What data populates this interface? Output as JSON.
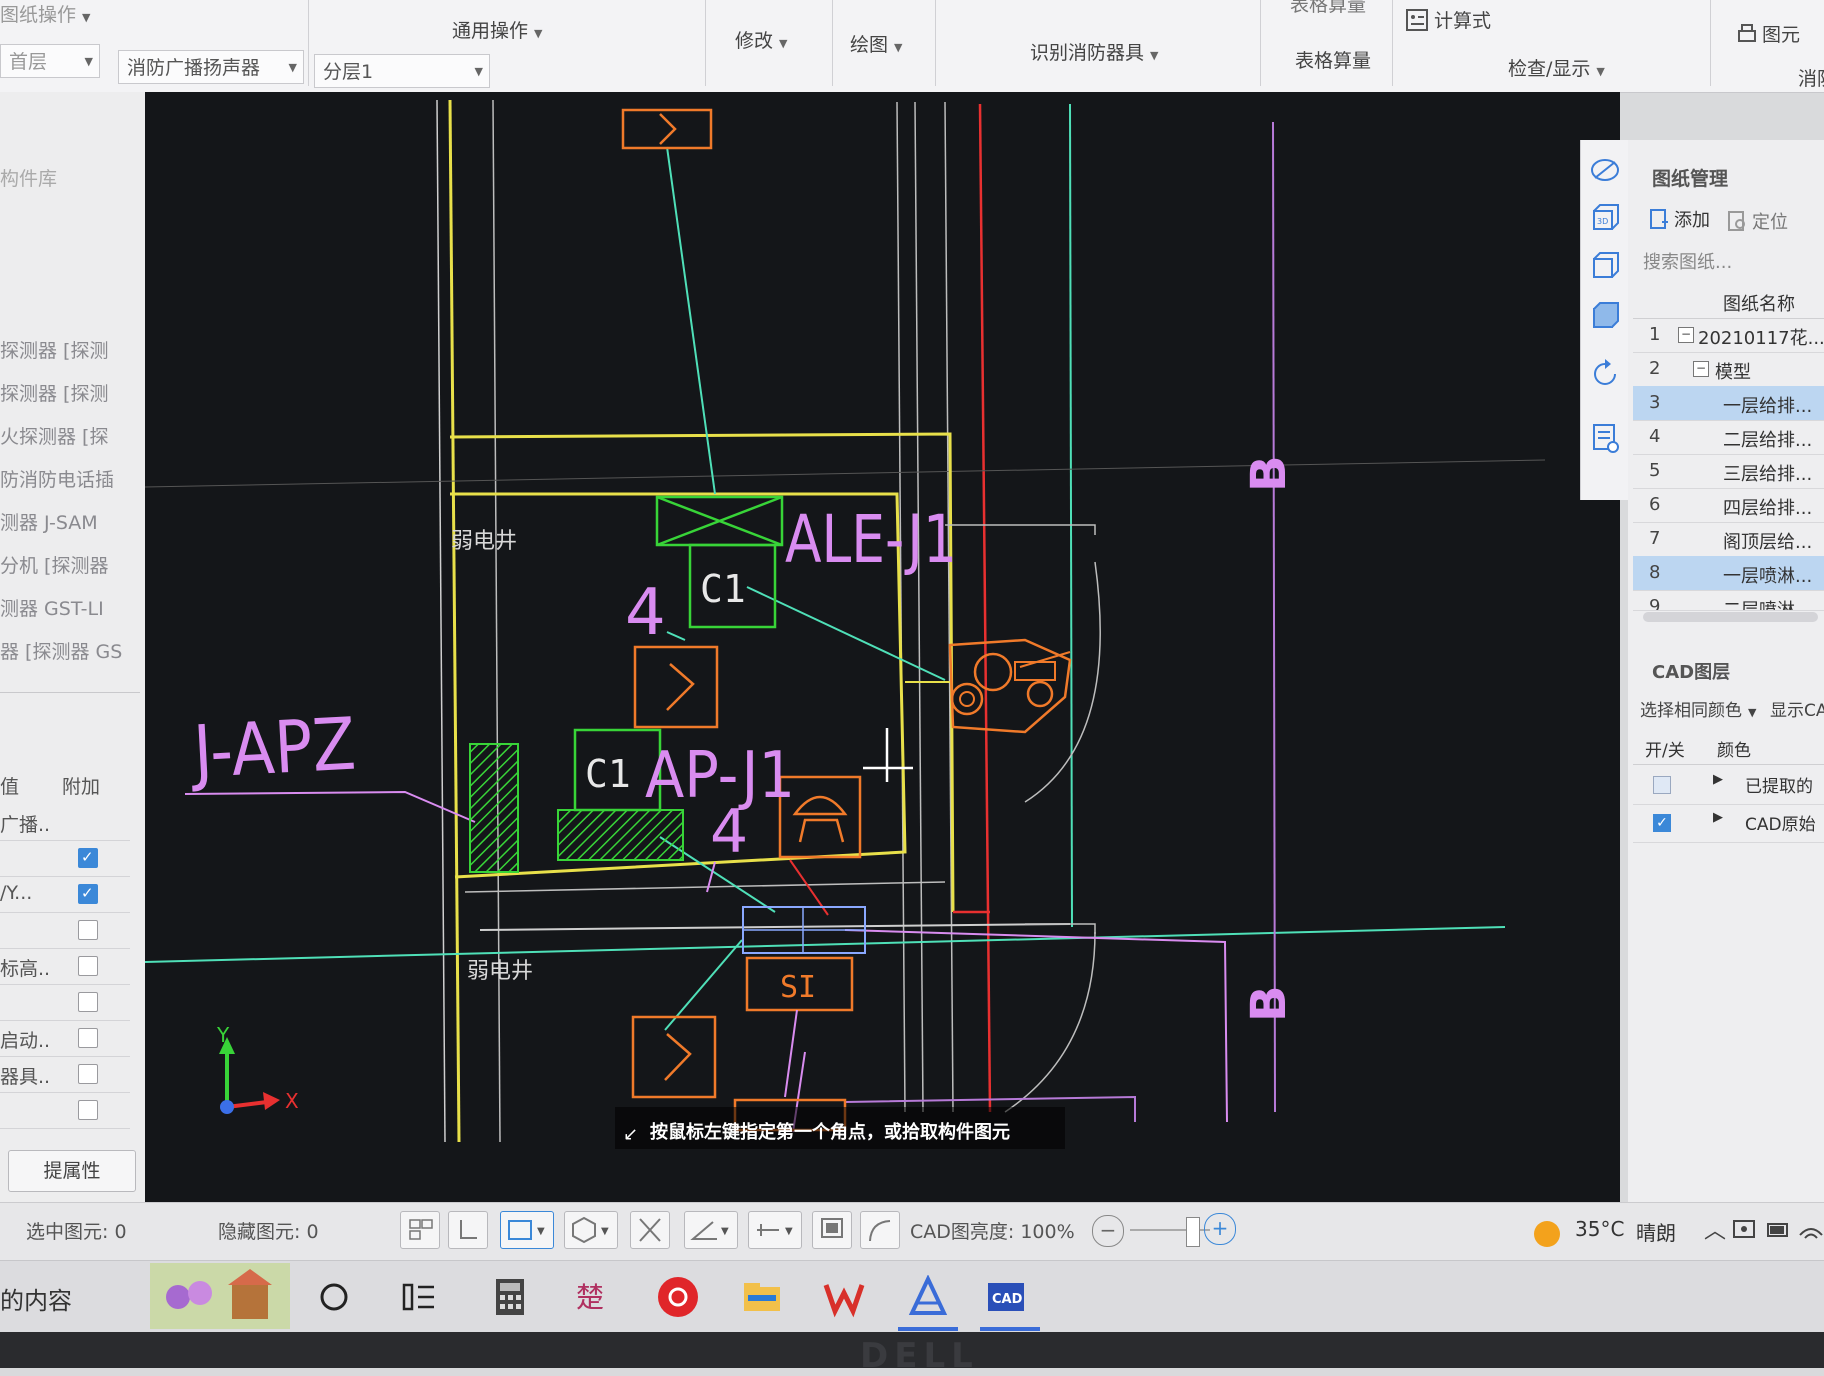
{
  "ribbon": {
    "group_partial": "图纸操作",
    "general_ops": "通用操作",
    "modify": "修改",
    "draw": "绘图",
    "identify_fire": "识别消防器具",
    "table_calc_top": "表格算量",
    "table_calc": "表格算量",
    "formula": "计算式",
    "check_display": "检查/显示",
    "component_partial": "图元",
    "fire_partial": "消防"
  },
  "selectors": {
    "floor_combo": "首层",
    "component_combo": "消防广播扬声器",
    "layer_combo": "分层1"
  },
  "left_panel": {
    "search_label": "构件库",
    "items": [
      "探测器 [探测",
      "探测器 [探测",
      "火探测器 [探",
      "防消防电话插",
      "测器 J-SAM",
      "分机 [探测器",
      "测器 GST-LI",
      "器 [探测器 GS"
    ],
    "prop_header_value": "值",
    "prop_header_extra": "附加",
    "props": [
      {
        "key": "广播...",
        "checked": null
      },
      {
        "key": "",
        "checked": true
      },
      {
        "key": "/Y...",
        "checked": true
      },
      {
        "key": "",
        "checked": false
      },
      {
        "key": "标高...",
        "checked": false
      },
      {
        "key": "",
        "checked": false
      },
      {
        "key": "启动...",
        "checked": false
      },
      {
        "key": "器具...",
        "checked": false
      },
      {
        "key": "",
        "checked": false
      }
    ],
    "props_button": "提属性"
  },
  "cad": {
    "labels": {
      "ale": "ALE-J1",
      "apz": "J-APZ",
      "ap": "AP-J1",
      "c1_top": "C1",
      "c1_bottom": "C1",
      "four_1": "4",
      "four_2": "4",
      "si": "SI",
      "weak_well_1": "弱电井",
      "weak_well_2": "弱电井",
      "grid_b_top": "B",
      "grid_b_bottom": "B",
      "axis_x": "X",
      "axis_y": "Y"
    },
    "prompt": "按鼠标左键指定第一个角点，或拾取构件图元",
    "colors": {
      "background": "#141619",
      "yellow": "#e8e04a",
      "green": "#38d438",
      "cyan": "#4fe0b8",
      "magenta": "#d98cf0",
      "orange": "#f07a2a",
      "red": "#e83030",
      "white": "#e8e8e8",
      "grey": "#9a9a9a"
    }
  },
  "right_panel": {
    "drawing_mgmt_title": "图纸管理",
    "add": "添加",
    "locate": "定位",
    "search_placeholder": "搜索图纸...",
    "col_name": "图纸名称",
    "drawings": [
      {
        "num": "1",
        "name": "20210117花...",
        "expander": "−",
        "selected": false
      },
      {
        "num": "2",
        "name": "模型",
        "expander": "−",
        "selected": false
      },
      {
        "num": "3",
        "name": "一层给排...",
        "expander": null,
        "selected": true
      },
      {
        "num": "4",
        "name": "二层给排...",
        "expander": null,
        "selected": false
      },
      {
        "num": "5",
        "name": "三层给排...",
        "expander": null,
        "selected": false
      },
      {
        "num": "6",
        "name": "四层给排...",
        "expander": null,
        "selected": false
      },
      {
        "num": "7",
        "name": "阁顶层给...",
        "expander": null,
        "selected": false
      },
      {
        "num": "8",
        "name": "一层喷淋...",
        "expander": null,
        "selected": true
      },
      {
        "num": "9",
        "name": "二层喷淋",
        "expander": null,
        "selected": false
      }
    ],
    "cad_layer_title": "CAD图层",
    "same_color": "选择相同颜色",
    "show_cad": "显示CAD",
    "col_toggle": "开/关",
    "col_color": "颜色",
    "layers": [
      {
        "name": "已提取的",
        "checked": false
      },
      {
        "name": "CAD原始",
        "checked": true
      }
    ]
  },
  "statusbar": {
    "selected": "选中图元: 0",
    "hidden": "隐藏图元: 0",
    "brightness_label": "CAD图亮度: 100%",
    "weather_temp": "35°C",
    "weather_desc": "晴朗"
  },
  "taskbar": {
    "search_partial": "的内容"
  },
  "brand": "DELL"
}
